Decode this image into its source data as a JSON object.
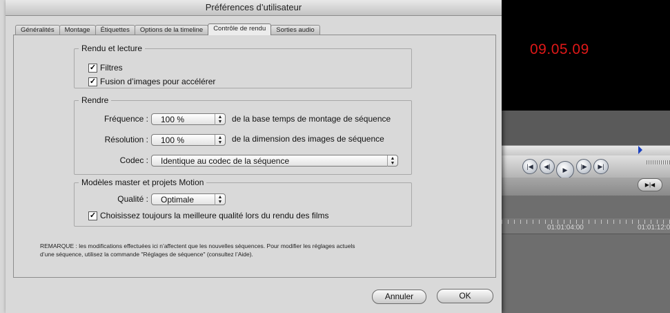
{
  "window_title": "Préférences d’utilisateur",
  "tabs": [
    {
      "label": "Généralités"
    },
    {
      "label": "Montage"
    },
    {
      "label": "Étiquettes"
    },
    {
      "label": "Options de la timeline"
    },
    {
      "label": "Contrôle de rendu"
    },
    {
      "label": "Sorties audio"
    }
  ],
  "active_tab": "Contrôle de rendu",
  "rendu_lecture": {
    "title": "Rendu et lecture",
    "filtres": {
      "label": "Filtres",
      "checked": true
    },
    "fusion": {
      "label": "Fusion d’images pour accélérer",
      "checked": true
    }
  },
  "rendre": {
    "title": "Rendre",
    "frequence_label": "Fréquence :",
    "frequence_value": "100 %",
    "frequence_suffix": "de la base temps de montage de séquence",
    "resolution_label": "Résolution :",
    "resolution_value": "100 %",
    "resolution_suffix": "de la dimension des images de séquence",
    "codec_label": "Codec :",
    "codec_value": "Identique au codec de la séquence"
  },
  "modeles": {
    "title": "Modèles master et projets Motion",
    "qualite_label": "Qualité :",
    "qualite_value": "Optimale",
    "meilleure": {
      "label": "Choisissez toujours la meilleure qualité lors du rendu des films",
      "checked": true
    }
  },
  "note_line1": "REMARQUE : les modifications effectuées ici n’affectent que les nouvelles séquences. Pour modifier les réglages actuels",
  "note_line2": "d’une séquence, utilisez la commande \"Réglages de séquence\" (consultez l’Aide).",
  "buttons": {
    "cancel": "Annuler",
    "ok": "OK"
  },
  "background": {
    "viewer_timecode": "09.05.09",
    "timeline_tc1": "01:01:04:00",
    "timeline_tc2": "01:01:12:0"
  },
  "colors": {
    "timecode": "#e01818",
    "dialog_bg": "#d9d9d9",
    "viewer_bg": "#000000"
  }
}
